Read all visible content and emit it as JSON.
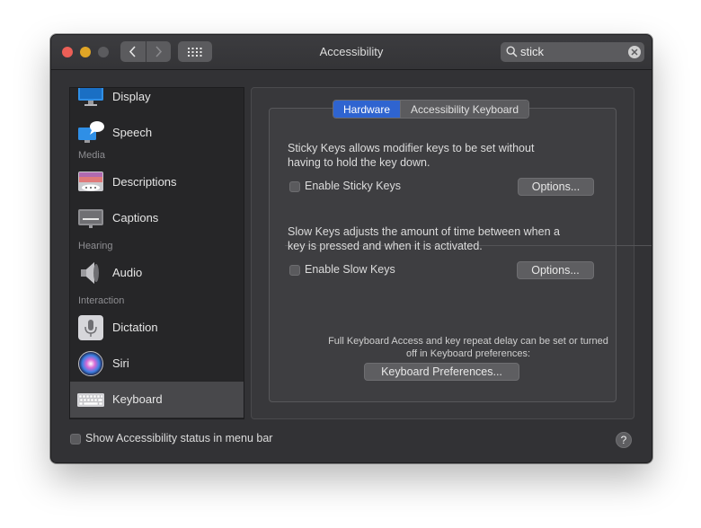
{
  "window": {
    "title": "Accessibility"
  },
  "search": {
    "value": "stick"
  },
  "sidebar": {
    "items": [
      {
        "label": "Display",
        "icon": "display-icon"
      },
      {
        "label": "Speech",
        "icon": "speech-icon"
      },
      {
        "label": "Descriptions",
        "icon": "descriptions-icon"
      },
      {
        "label": "Captions",
        "icon": "captions-icon"
      },
      {
        "label": "Audio",
        "icon": "speaker-icon"
      },
      {
        "label": "Dictation",
        "icon": "microphone-icon"
      },
      {
        "label": "Siri",
        "icon": "siri-icon"
      },
      {
        "label": "Keyboard",
        "icon": "keyboard-icon",
        "selected": true
      }
    ],
    "headers": {
      "media": "Media",
      "hearing": "Hearing",
      "interaction": "Interaction"
    }
  },
  "tabs": [
    {
      "label": "Hardware",
      "active": true
    },
    {
      "label": "Accessibility Keyboard",
      "active": false
    }
  ],
  "sticky": {
    "desc_line1": "Sticky Keys allows modifier keys to be set without",
    "desc_line2": "having to hold the key down.",
    "checkbox_label": "Enable Sticky Keys",
    "checked": false,
    "options_label": "Options..."
  },
  "slow": {
    "desc_line1": "Slow Keys adjusts the amount of time between when a",
    "desc_line2": "key is pressed and when it is activated.",
    "checkbox_label": "Enable Slow Keys",
    "checked": false,
    "options_label": "Options..."
  },
  "footer_note": {
    "line1": "Full Keyboard Access and key repeat delay can be set or turned",
    "line2": "off in Keyboard preferences:"
  },
  "keyboard_prefs_button": "Keyboard Preferences...",
  "status_menu": {
    "label": "Show Accessibility status in menu bar",
    "checked": false
  },
  "help": {
    "label": "?"
  },
  "colors": {
    "accent": "#2f64d0",
    "window_bg": "#323235",
    "sidebar_bg": "#262628"
  }
}
